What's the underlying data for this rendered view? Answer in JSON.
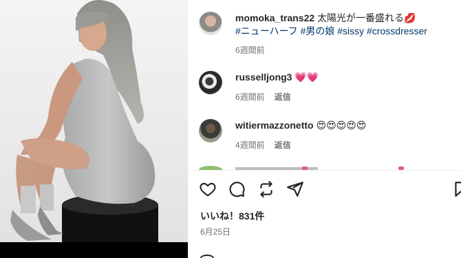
{
  "post": {
    "caption": {
      "username": "momoka_trans22",
      "text": "太陽光が一番盛れる💋",
      "hashtags": [
        "#ニューハーフ",
        "#男の娘",
        "#sissy",
        "#crossdresser"
      ],
      "time": "6週間前"
    },
    "comments": [
      {
        "username": "russelljong3",
        "text": "💗💗",
        "time": "6週間前",
        "reply_label": "返信"
      },
      {
        "username": "witiermazzonetto",
        "text": "😍😍😍😍😍",
        "time": "4週間前",
        "reply_label": "返信"
      }
    ],
    "likes": "いいね！831件",
    "date": "6月25日"
  }
}
